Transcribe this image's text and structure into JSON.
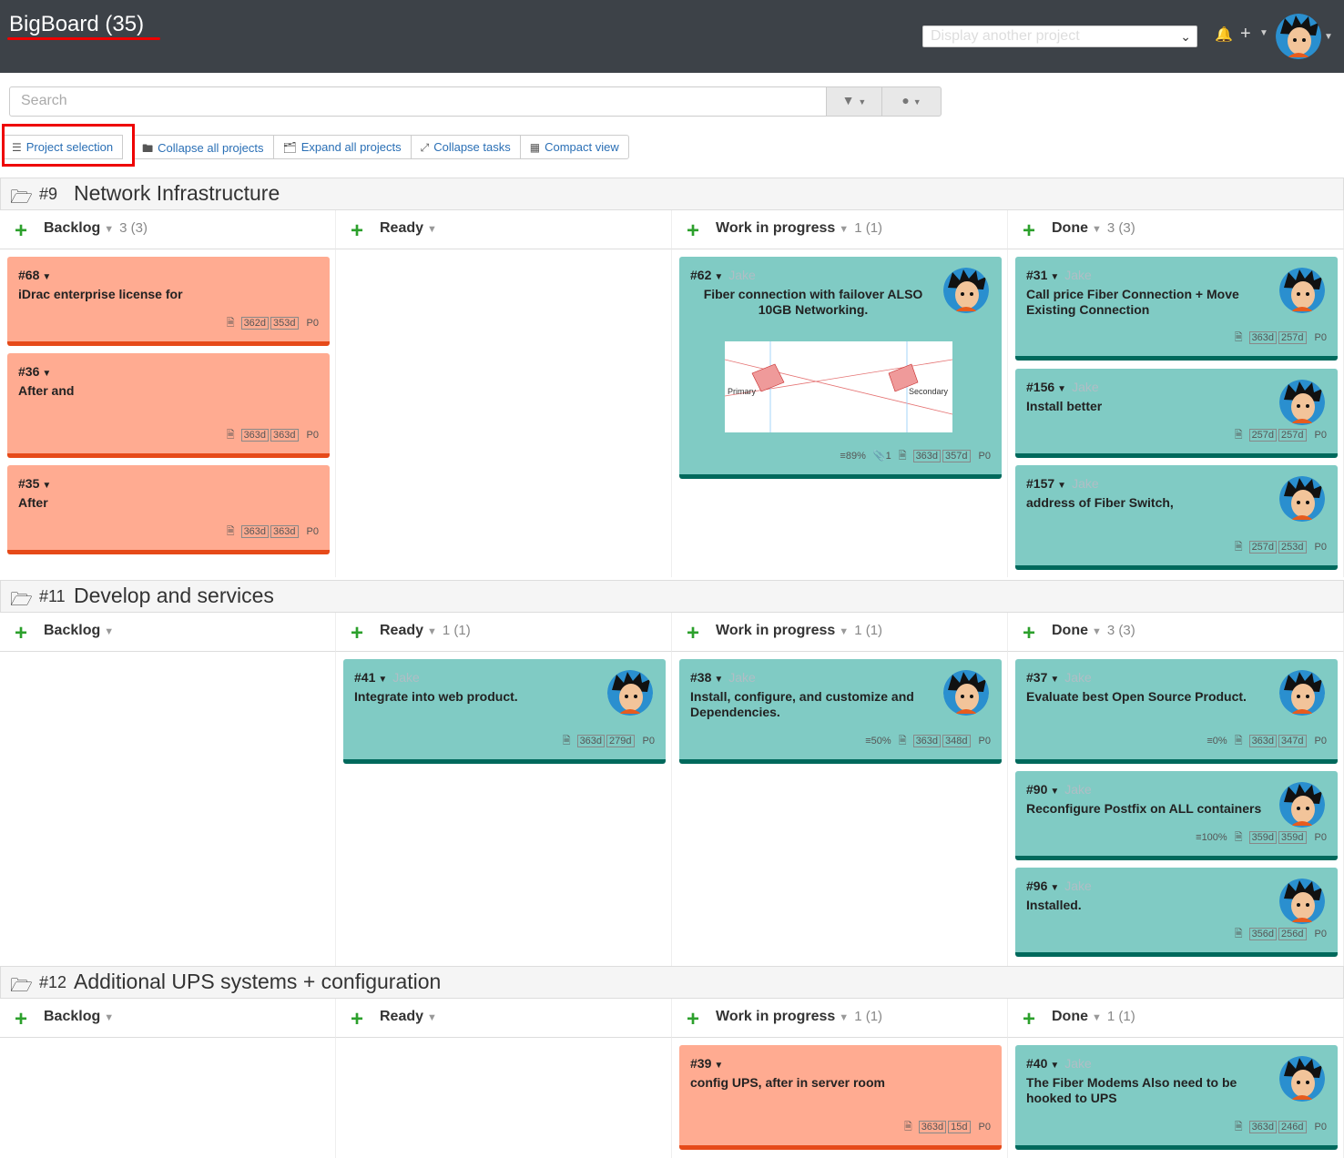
{
  "header": {
    "title": "BigBoard (35)",
    "project_select_placeholder": "Display another project"
  },
  "search": {
    "placeholder": "Search"
  },
  "toolbar": {
    "project_selection": "Project selection",
    "collapse_all": "Collapse all projects",
    "expand_all": "Expand all projects",
    "collapse_tasks": "Collapse tasks",
    "compact_view": "Compact view"
  },
  "projects": [
    {
      "num": "#9",
      "name": "Network Infrastructure",
      "columns": [
        {
          "title": "Backlog",
          "count": "3 (3)"
        },
        {
          "title": "Ready",
          "count": ""
        },
        {
          "title": "Work in progress",
          "count": "1 (1)"
        },
        {
          "title": "Done",
          "count": "3 (3)"
        }
      ],
      "cards": [
        {
          "id": "#68",
          "user": "",
          "text": "iDrac enterprise license for",
          "days1": "362d",
          "days2": "353d",
          "priority": "P0",
          "progress": "",
          "attach": ""
        },
        {
          "id": "#36",
          "user": "",
          "text": "After         and",
          "days1": "363d",
          "days2": "363d",
          "priority": "P0",
          "progress": "",
          "attach": ""
        },
        {
          "id": "#35",
          "user": "",
          "text": "After",
          "days1": "363d",
          "days2": "363d",
          "priority": "P0",
          "progress": "",
          "attach": ""
        },
        {
          "id": "#62",
          "user": "Jake",
          "text": "Fiber connection with failover ALSO 10GB Networking.",
          "days1": "363d",
          "days2": "357d",
          "priority": "P0",
          "progress": "89%",
          "attach": "1"
        },
        {
          "id": "#31",
          "user": "Jake",
          "text": "Call             price Fiber Connection + Move Existing Connection",
          "days1": "363d",
          "days2": "257d",
          "priority": "P0",
          "progress": "",
          "attach": ""
        },
        {
          "id": "#156",
          "user": "Jake",
          "text": "Install better",
          "days1": "257d",
          "days2": "257d",
          "priority": "P0",
          "progress": "",
          "attach": ""
        },
        {
          "id": "#157",
          "user": "Jake",
          "text": "address of Fiber Switch,",
          "days1": "257d",
          "days2": "253d",
          "priority": "P0",
          "progress": "",
          "attach": ""
        }
      ]
    },
    {
      "num": "#11",
      "name": "Develop                 and                               services",
      "columns": [
        {
          "title": "Backlog",
          "count": ""
        },
        {
          "title": "Ready",
          "count": "1 (1)"
        },
        {
          "title": "Work in progress",
          "count": "1 (1)"
        },
        {
          "title": "Done",
          "count": "3 (3)"
        }
      ],
      "cards": [
        {
          "id": "#41",
          "user": "Jake",
          "text": "Integrate into web product.",
          "days1": "363d",
          "days2": "279d",
          "priority": "P0",
          "progress": "",
          "attach": ""
        },
        {
          "id": "#38",
          "user": "Jake",
          "text": "Install, configure, and customize and Dependencies.",
          "days1": "363d",
          "days2": "348d",
          "priority": "P0",
          "progress": "50%",
          "attach": ""
        },
        {
          "id": "#37",
          "user": "Jake",
          "text": "Evaluate best Open Source Product.",
          "days1": "363d",
          "days2": "347d",
          "priority": "P0",
          "progress": "0%",
          "attach": ""
        },
        {
          "id": "#90",
          "user": "Jake",
          "text": "Reconfigure Postfix on ALL containers",
          "days1": "359d",
          "days2": "359d",
          "priority": "P0",
          "progress": "100%",
          "attach": ""
        },
        {
          "id": "#96",
          "user": "Jake",
          "text": "Installed.",
          "days1": "356d",
          "days2": "256d",
          "priority": "P0",
          "progress": "",
          "attach": ""
        }
      ]
    },
    {
      "num": "#12",
      "name": "Additional UPS systems +                    configuration",
      "columns": [
        {
          "title": "Backlog",
          "count": ""
        },
        {
          "title": "Ready",
          "count": ""
        },
        {
          "title": "Work in progress",
          "count": "1 (1)"
        },
        {
          "title": "Done",
          "count": "1 (1)"
        }
      ],
      "cards": [
        {
          "id": "#39",
          "user": "",
          "text": "config UPS, after in server room",
          "days1": "363d",
          "days2": "15d",
          "priority": "P0",
          "progress": "",
          "attach": ""
        },
        {
          "id": "#40",
          "user": "Jake",
          "text": "The Fiber Modems Also need to be hooked to UPS",
          "days1": "363d",
          "days2": "246d",
          "priority": "P0",
          "progress": "",
          "attach": ""
        }
      ]
    }
  ],
  "diagram_labels": {
    "primary": "Primary",
    "secondary": "Secondary"
  }
}
